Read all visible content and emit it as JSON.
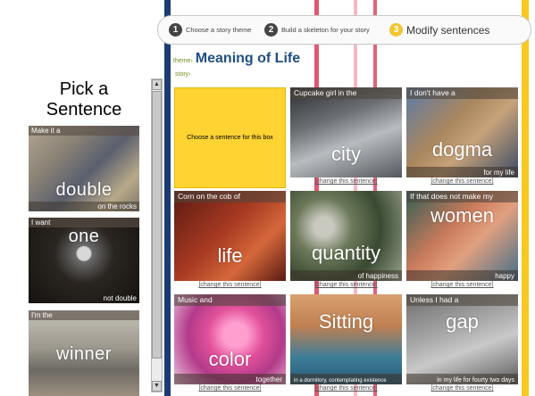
{
  "palette": {
    "accent_yellow": "#ffd332",
    "nav_blue": "#1e4f86",
    "theme_green": "#6a8f1f",
    "stripe_navy": "#1c3b73",
    "stripe_red": "#d62040",
    "stripe_pink": "#f2a7b8",
    "stripe_yellow": "#f6c820"
  },
  "steps": [
    {
      "num": "1",
      "label": "Choose a story theme"
    },
    {
      "num": "2",
      "label": "Build a skeleton for your story"
    },
    {
      "num": "3",
      "label": "Modify sentences"
    }
  ],
  "left_panel": {
    "title": "Pick a Sentence",
    "items": [
      {
        "caption": "Make it a",
        "big": "double",
        "small": "on the rocks"
      },
      {
        "caption": "I want",
        "big": "one",
        "small": "not double"
      },
      {
        "caption": "I'm the",
        "big": "winner",
        "small": ""
      }
    ],
    "scroll_up": "▲",
    "scroll_down": "▼"
  },
  "theme": {
    "label": "theme›",
    "value": "Meaning of Life"
  },
  "story": {
    "label": "story›"
  },
  "selected_box_text": "Choose a sentence for this box",
  "change_label": "[change this sentence]",
  "cells": [
    {
      "caption": "Cupcake girl in the",
      "big": "city",
      "small": ""
    },
    {
      "caption": "I don't have a",
      "big": "dogma",
      "small": "for my life"
    },
    {
      "caption": "Corn on the cob of",
      "big": "life",
      "small": ""
    },
    {
      "caption": "",
      "big": "quantity",
      "small": "of happiness"
    },
    {
      "caption": "If that does not make my",
      "big": "women",
      "small": "happy"
    },
    {
      "caption": "Music and",
      "big": "color",
      "small": "together"
    },
    {
      "caption": "",
      "big": "Sitting",
      "small": "in a dormitory, contemplating existence"
    },
    {
      "caption": "Unless I had a",
      "big": "gap",
      "small": "in my life for fourty two days"
    }
  ]
}
